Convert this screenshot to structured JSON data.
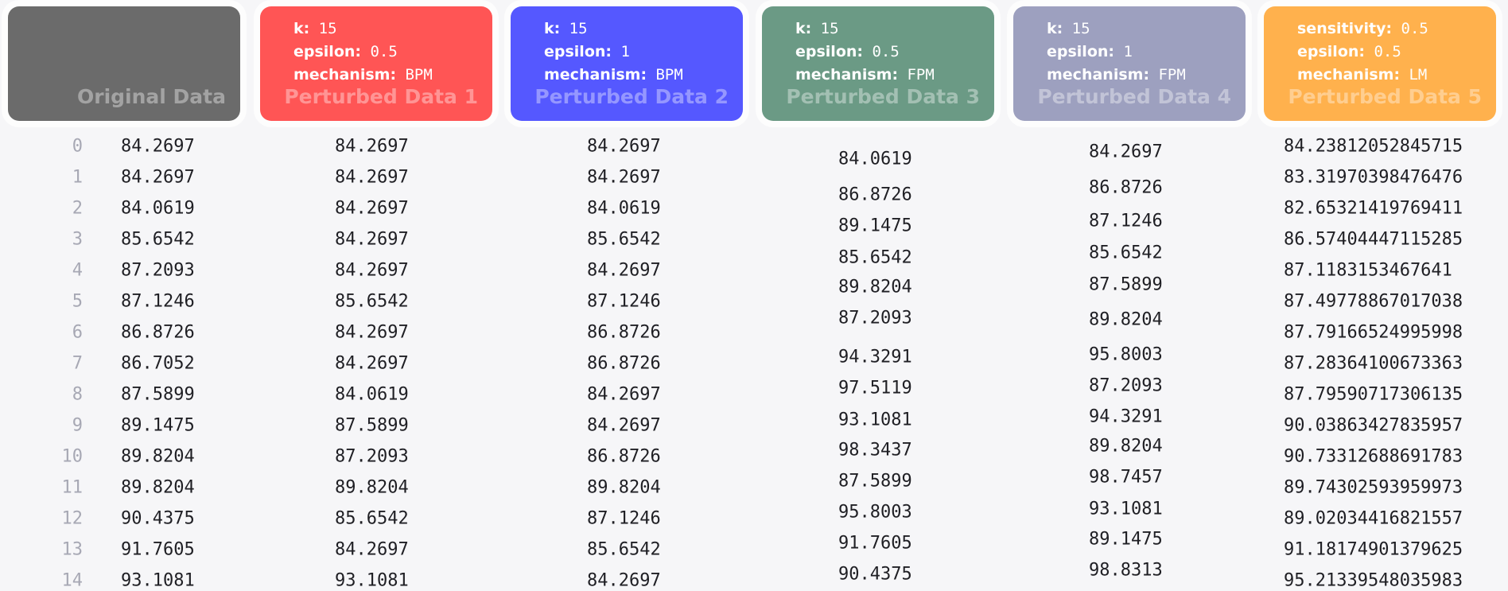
{
  "cards": [
    {
      "title": "Original Data",
      "color": "#6b6b6b",
      "params": []
    },
    {
      "title": "Perturbed Data 1",
      "color": "#ff5555",
      "params": [
        {
          "k": "k:",
          "v": "15"
        },
        {
          "k": "epsilon:",
          "v": "0.5"
        },
        {
          "k": "mechanism:",
          "v": "BPM"
        }
      ]
    },
    {
      "title": "Perturbed Data 2",
      "color": "#5558ff",
      "params": [
        {
          "k": "k:",
          "v": "15"
        },
        {
          "k": "epsilon:",
          "v": "1"
        },
        {
          "k": "mechanism:",
          "v": "BPM"
        }
      ]
    },
    {
      "title": "Perturbed Data 3",
      "color": "#6b9a85",
      "params": [
        {
          "k": "k:",
          "v": "15"
        },
        {
          "k": "epsilon:",
          "v": "0.5"
        },
        {
          "k": "mechanism:",
          "v": "FPM"
        }
      ]
    },
    {
      "title": "Perturbed Data 4",
      "color": "#9da0bf",
      "params": [
        {
          "k": "k:",
          "v": "15"
        },
        {
          "k": "epsilon:",
          "v": "1"
        },
        {
          "k": "mechanism:",
          "v": "FPM"
        }
      ]
    },
    {
      "title": "Perturbed Data 5",
      "color": "#ffb14d",
      "params": [
        {
          "k": "sensitivity:",
          "v": "0.5"
        },
        {
          "k": "epsilon:",
          "v": "0.5"
        },
        {
          "k": "mechanism:",
          "v": "LM"
        }
      ]
    }
  ],
  "index": [
    "0",
    "1",
    "2",
    "3",
    "4",
    "5",
    "6",
    "7",
    "8",
    "9",
    "10",
    "11",
    "12",
    "13",
    "14"
  ],
  "columns": [
    {
      "name": "original",
      "values": [
        "84.2697",
        "84.2697",
        "84.0619",
        "85.6542",
        "87.2093",
        "87.1246",
        "86.8726",
        "86.7052",
        "87.5899",
        "89.1475",
        "89.8204",
        "89.8204",
        "90.4375",
        "91.7605",
        "93.1081"
      ]
    },
    {
      "name": "perturbed-1",
      "values": [
        "84.2697",
        "84.2697",
        "84.2697",
        "84.2697",
        "84.2697",
        "85.6542",
        "84.2697",
        "84.2697",
        "84.0619",
        "87.5899",
        "87.2093",
        "89.8204",
        "85.6542",
        "84.2697",
        "93.1081"
      ]
    },
    {
      "name": "perturbed-2",
      "values": [
        "84.2697",
        "84.2697",
        "84.0619",
        "85.6542",
        "84.2697",
        "87.1246",
        "86.8726",
        "86.8726",
        "84.2697",
        "84.2697",
        "86.8726",
        "89.8204",
        "87.1246",
        "85.6542",
        "84.2697"
      ]
    },
    {
      "name": "perturbed-3",
      "values": [
        "84.0619",
        "86.8726",
        "89.1475",
        "85.6542",
        "89.8204",
        "87.2093",
        "94.3291",
        "97.5119",
        "93.1081",
        "98.3437",
        "87.5899",
        "95.8003",
        "91.7605",
        "90.4375"
      ]
    },
    {
      "name": "perturbed-4",
      "values": [
        "84.2697",
        "86.8726",
        "87.1246",
        "85.6542",
        "87.5899",
        "89.8204",
        "95.8003",
        "87.2093",
        "94.3291",
        "89.8204",
        "98.7457",
        "93.1081",
        "89.1475",
        "98.8313"
      ]
    },
    {
      "name": "perturbed-5",
      "values": [
        "84.23812052845715",
        "83.31970398476476",
        "82.65321419769411",
        "86.57404447115285",
        "87.1183153467641",
        "87.49778867017038",
        "87.79166524995998",
        "87.28364100673363",
        "87.79590717306135",
        "90.03863427835957",
        "90.73312688691783",
        "89.74302593959973",
        "89.02034416821557",
        "91.18174901379625",
        "95.21339548035983"
      ]
    }
  ]
}
